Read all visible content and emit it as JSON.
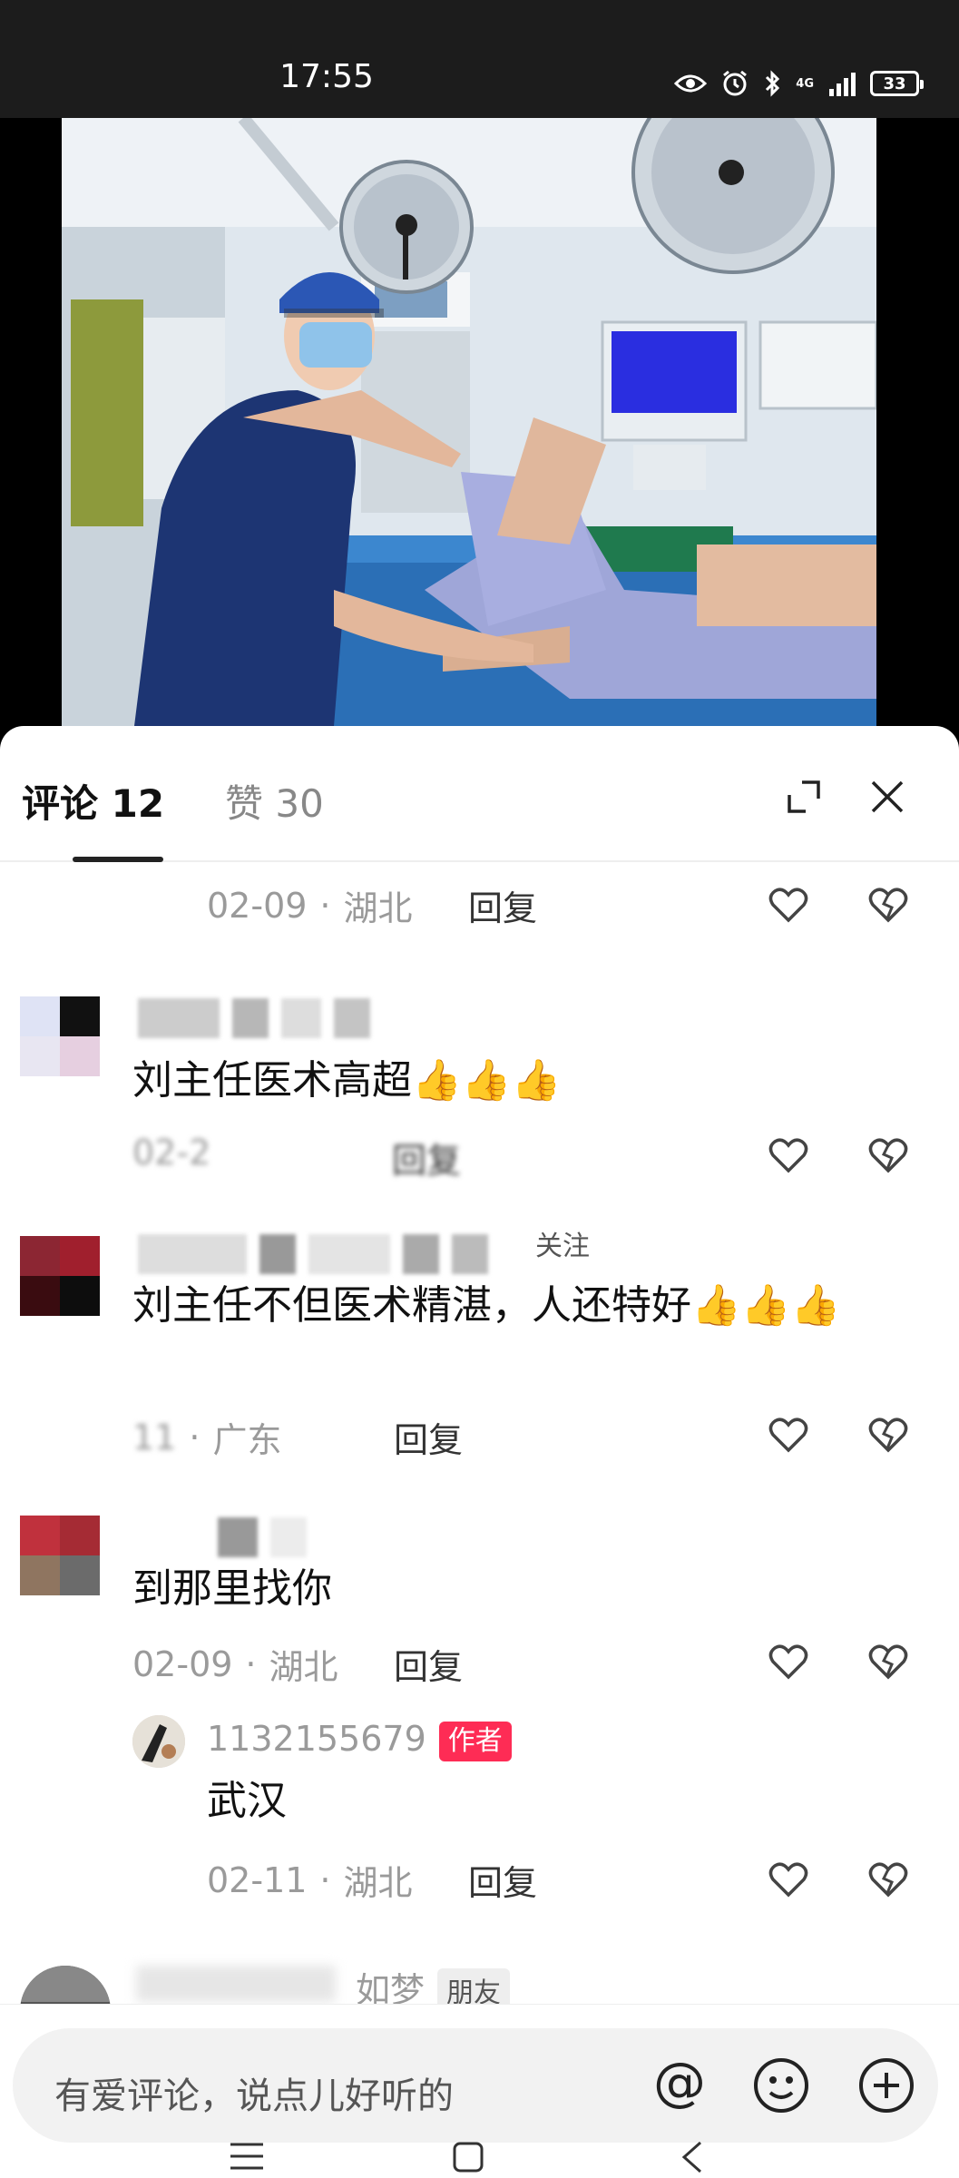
{
  "status_bar": {
    "time": "17:55",
    "network": "4G",
    "battery": "33"
  },
  "tabs": {
    "comments_label": "评论 12",
    "likes_label": "赞 30"
  },
  "comments": [
    {
      "date": "02-09",
      "location": "湖北",
      "reply_label": "回复"
    },
    {
      "text": "刘主任医术高超",
      "emoji": "👍👍👍",
      "date": "02-2",
      "reply_label": "回复"
    },
    {
      "username_suffix": "关注",
      "text": "刘主任不但医术精湛，人还特好",
      "emoji": "👍👍👍",
      "date": "11",
      "location": "广东",
      "reply_label": "回复"
    },
    {
      "text": "到那里找你",
      "date": "02-09",
      "location": "湖北",
      "reply_label": "回复"
    }
  ],
  "reply": {
    "username": "1132155679",
    "badge": "作者",
    "text": "武汉",
    "date": "02-11",
    "location": "湖北",
    "reply_label": "回复"
  },
  "next_comment": {
    "username_partial": "如梦",
    "badge": "朋友"
  },
  "input": {
    "placeholder": "有爱评论，说点儿好听的",
    "at_symbol": "@"
  },
  "colors": {
    "accent": "#fe2c55",
    "meta_text": "#9a9a9a",
    "status_bar_bg": "#1c1c1c"
  }
}
